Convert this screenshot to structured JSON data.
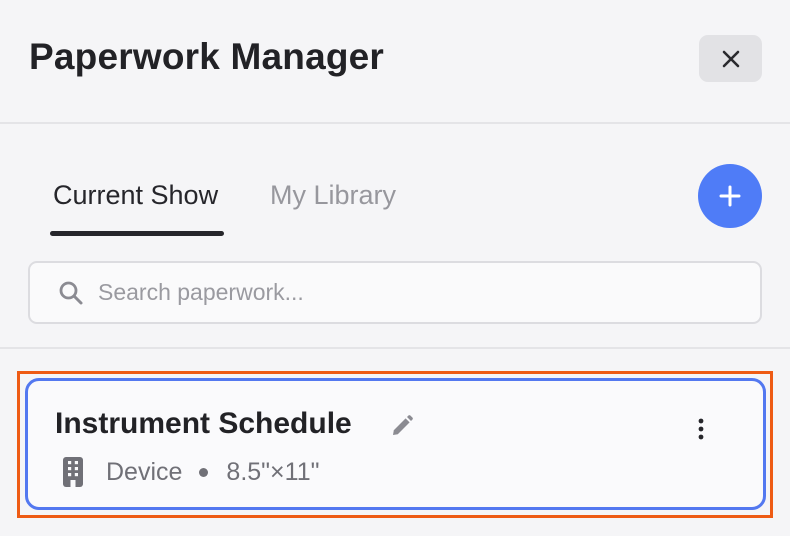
{
  "header": {
    "title": "Paperwork Manager",
    "close_icon": "close-icon"
  },
  "tabs": [
    {
      "label": "Current Show",
      "active": true
    },
    {
      "label": "My Library",
      "active": false
    }
  ],
  "add_button": {
    "icon": "plus-icon",
    "color": "#4f7cf7"
  },
  "search": {
    "placeholder": "Search paperwork...",
    "value": "",
    "icon": "search-icon"
  },
  "paperwork_items": [
    {
      "title": "Instrument Schedule",
      "type": "Device",
      "size": "8.5\"×11\"",
      "type_icon": "device-icon",
      "edit_icon": "pencil-icon",
      "menu_icon": "more-vertical-icon",
      "selected": true
    }
  ],
  "colors": {
    "accent": "#4f7cf7",
    "card_border": "#5378f0",
    "highlight": "#ee5b14"
  }
}
